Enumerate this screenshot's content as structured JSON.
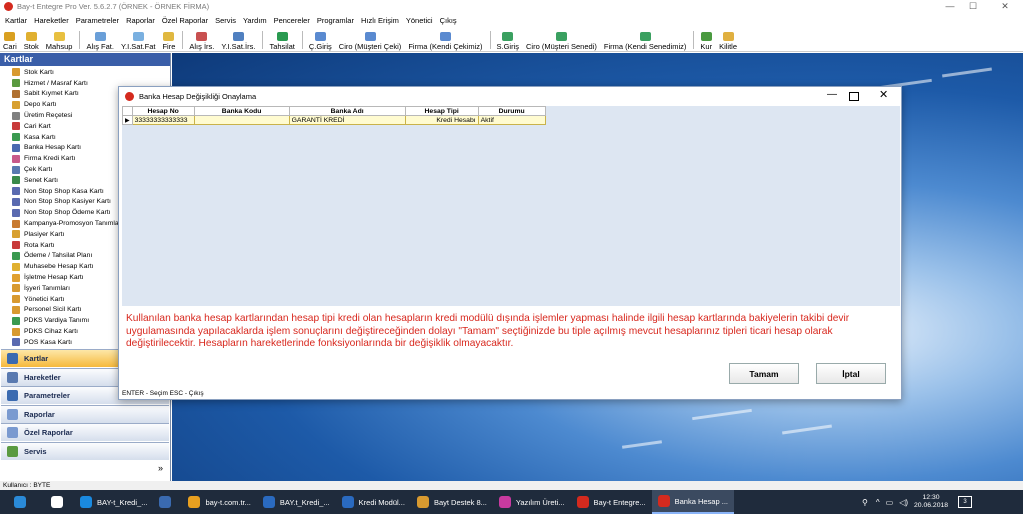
{
  "app": {
    "title": "Bay-t Entegre Pro Ver. 5.6.2.7 (ÖRNEK - ÖRNEK FİRMA)"
  },
  "window_controls": {
    "minimize": "—",
    "maximize": "☐",
    "close": "✕"
  },
  "menu": [
    "Kartlar",
    "Hareketler",
    "Parametreler",
    "Raporlar",
    "Özel Raporlar",
    "Servis",
    "Yardım",
    "Pencereler",
    "Programlar",
    "Hızlı Erişim",
    "Yönetici",
    "Çıkış"
  ],
  "toolbar": [
    {
      "label": "Cari",
      "color": "#d9a020"
    },
    {
      "label": "Stok",
      "color": "#e0b030"
    },
    {
      "label": "Mahsup",
      "color": "#e8c040"
    },
    {
      "label": "Alış Fat.",
      "color": "#6a9fd8"
    },
    {
      "label": "Y.I.Sat.Fat",
      "color": "#7ab0e0"
    },
    {
      "label": "Fire",
      "color": "#e0b840"
    },
    {
      "label": "Alış İrs.",
      "color": "#c85050"
    },
    {
      "label": "Y.I.Sat.İrs.",
      "color": "#5080c0"
    },
    {
      "label": "Tahsilat",
      "color": "#2a9a50"
    },
    {
      "label": "Ç.Giriş",
      "color": "#5a8ad0"
    },
    {
      "label": "Ciro (Müşteri Çeki)",
      "color": "#5a8ad0"
    },
    {
      "label": "Firma (Kendi Çekimiz)",
      "color": "#5a8ad0"
    },
    {
      "label": "S.Giriş",
      "color": "#3aa060"
    },
    {
      "label": "Ciro (Müşteri Senedi)",
      "color": "#3aa060"
    },
    {
      "label": "Firma (Kendi Senedimiz)",
      "color": "#3aa060"
    },
    {
      "label": "Kur",
      "color": "#4a9a40"
    },
    {
      "label": "Kilitle",
      "color": "#e0b040"
    }
  ],
  "sidebar": {
    "header": "Kartlar",
    "items": [
      {
        "label": "Stok Kartı",
        "color": "#d89a30"
      },
      {
        "label": "Hizmet / Masraf Kartı",
        "color": "#5a9a40"
      },
      {
        "label": "Sabit Kıymet Kartı",
        "color": "#b07030"
      },
      {
        "label": "Depo Kartı",
        "color": "#d8a030"
      },
      {
        "label": "Üretim Reçetesi",
        "color": "#808080"
      },
      {
        "label": "Cari Kart",
        "color": "#c83a3a"
      },
      {
        "label": "Kasa Kartı",
        "color": "#3a9a50"
      },
      {
        "label": "Banka Hesap Kartı",
        "color": "#4a6ab0"
      },
      {
        "label": "Firma Kredi Kartı",
        "color": "#c85a8a"
      },
      {
        "label": "Çek Kartı",
        "color": "#5a7ab0"
      },
      {
        "label": "Senet Kartı",
        "color": "#3a8a4a"
      },
      {
        "label": "Non Stop Shop Kasa Kartı",
        "color": "#5a6ab0"
      },
      {
        "label": "Non Stop Shop Kasiyer Kartı",
        "color": "#5a6ab0"
      },
      {
        "label": "Non Stop Shop Ödeme Kartı",
        "color": "#5a6ab0"
      },
      {
        "label": "Kampanya-Promosyon Tanımları",
        "color": "#c87a30"
      },
      {
        "label": "Plasiyer Kartı",
        "color": "#d8a030"
      },
      {
        "label": "Rota Kartı",
        "color": "#c83a3a"
      },
      {
        "label": "Ödeme / Tahsilat Planı",
        "color": "#3a9a50"
      },
      {
        "label": "Muhasebe Hesap Kartı",
        "color": "#e0b030"
      },
      {
        "label": "İşletme Hesap Kartı",
        "color": "#e0a030"
      },
      {
        "label": "İşyeri Tanımları",
        "color": "#d89a30"
      },
      {
        "label": "Yönetici Kartı",
        "color": "#d89a30"
      },
      {
        "label": "Personel Sicil Kartı",
        "color": "#d89a30"
      },
      {
        "label": "PDKS Vardiya Tanımı",
        "color": "#3a9a50"
      },
      {
        "label": "PDKS Cihaz Kartı",
        "color": "#d89a30"
      },
      {
        "label": "POS Kasa Kartı",
        "color": "#5a6ab0"
      }
    ],
    "nav": [
      {
        "label": "Kartlar",
        "color": "#3a6ab0"
      },
      {
        "label": "Hareketler",
        "color": "#5a7ab0"
      },
      {
        "label": "Parametreler",
        "color": "#3a6ab0"
      },
      {
        "label": "Raporlar",
        "color": "#7a9ad0"
      },
      {
        "label": "Özel Raporlar",
        "color": "#7a9ad0"
      },
      {
        "label": "Servis",
        "color": "#5a9a40"
      }
    ],
    "scroll_glyph": "^",
    "more_glyph": "»"
  },
  "dialog": {
    "title": "Banka Hesap Değişikliği Onaylama",
    "columns": [
      "Hesap No",
      "Banka Kodu",
      "Banka Adı",
      "Hesap Tipi",
      "Durumu"
    ],
    "rows": [
      {
        "indicator": "▶",
        "hesap_no": "33333333333333",
        "banka_kodu": "",
        "banka_adi": "GARANTİ KREDİ",
        "hesap_tipi": "Kredi Hesabı",
        "durumu": "Aktif"
      }
    ],
    "message": "Kullanılan banka hesap kartlarından hesap tipi kredi olan hesapların kredi modülü dışında işlemler yapması halinde ilgili hesap kartlarında bakiyelerin takibi devir uygulamasında yapılacaklarda işlem sonuçlarını değiştireceğinden dolayı \"Tamam\" seçtiğinizde bu tiple açılmış mevcut hesaplarınız tipleri ticari hesap olarak değiştirilecektir. Hesapların hareketlerinde fonksiyonlarında bir değişiklik olmayacaktır.",
    "ok_label": "Tamam",
    "cancel_label": "İptal",
    "status": "ENTER - Seçim  ESC - Çıkış",
    "minimize": "—",
    "close": "✕"
  },
  "statusbar": {
    "user": "Kullanıcı : BYTE"
  },
  "taskbar": {
    "items": [
      {
        "label": "",
        "color": "#2a8ad8"
      },
      {
        "label": "",
        "color": "#ffffff"
      },
      {
        "label": "BAY-t_Kredi_...",
        "color": "#1a8ae0"
      },
      {
        "label": "",
        "color": "#3a6ab0"
      },
      {
        "label": "bay-t.com.tr...",
        "color": "#e8a020"
      },
      {
        "label": "BAY.t_Kredi_...",
        "color": "#2a6ac0"
      },
      {
        "label": "Kredi Modül...",
        "color": "#2a6ac0"
      },
      {
        "label": "Bayt Destek 8...",
        "color": "#d89a30"
      },
      {
        "label": "Yazılım Üreti...",
        "color": "#c83aa0"
      },
      {
        "label": "Bay-t Entegre...",
        "color": "#d42a1e"
      },
      {
        "label": "Banka Hesap ...",
        "color": "#d42a1e"
      }
    ],
    "clock": "12:30",
    "date": "20.06.2018",
    "notification_count": "3"
  }
}
